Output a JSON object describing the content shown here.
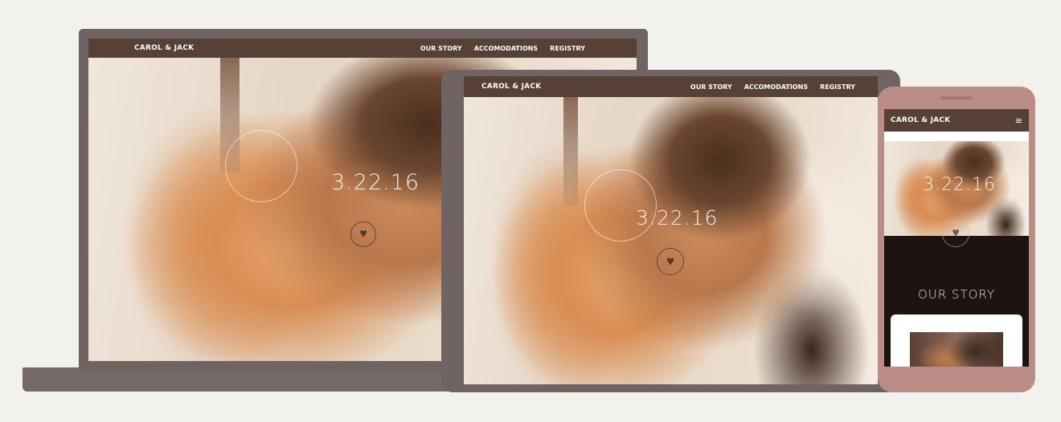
{
  "site": {
    "brand": "CAROL & JACK",
    "nav": [
      "OUR STORY",
      "ACCOMODATIONS",
      "REGISTRY"
    ],
    "date": "3.22.16",
    "menu_icon": "≡",
    "section_title": "OUR STORY"
  },
  "colors": {
    "nav_bg": "#574137",
    "device_frame": "#6f6462",
    "phone_frame": "#b98d86",
    "page_bg": "#f2f1ee"
  },
  "icons": {
    "heart": "heart-icon",
    "menu": "hamburger-menu-icon"
  }
}
